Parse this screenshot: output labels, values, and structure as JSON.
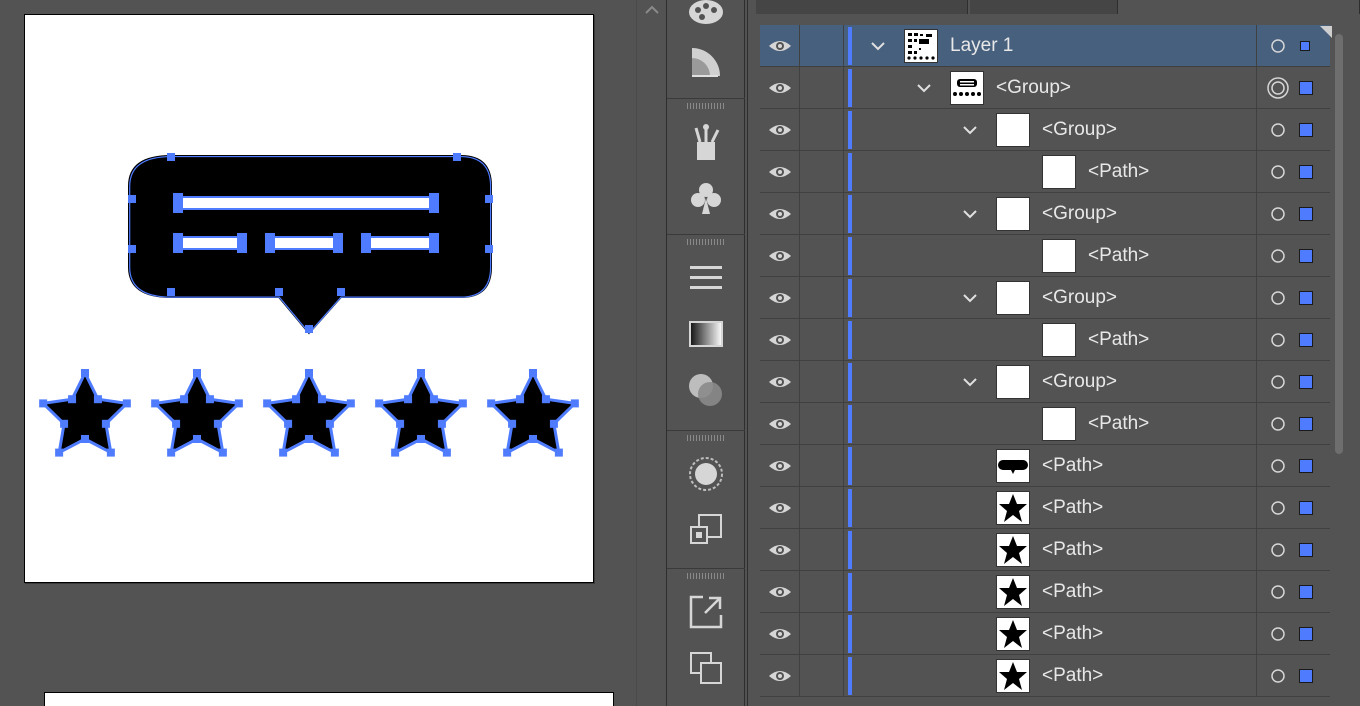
{
  "layers_panel": {
    "rows": [
      {
        "name": "Layer 1",
        "level": 0,
        "expandable": true,
        "thumb": "layer",
        "selected": true,
        "target": "circle"
      },
      {
        "name": "<Group>",
        "level": 1,
        "expandable": true,
        "thumb": "group-speech",
        "selected": false,
        "target": "double-circle"
      },
      {
        "name": "<Group>",
        "level": 2,
        "expandable": true,
        "thumb": "blank",
        "selected": false,
        "target": "circle"
      },
      {
        "name": "<Path>",
        "level": 3,
        "expandable": false,
        "thumb": "blank",
        "selected": false,
        "target": "circle"
      },
      {
        "name": "<Group>",
        "level": 2,
        "expandable": true,
        "thumb": "blank",
        "selected": false,
        "target": "circle"
      },
      {
        "name": "<Path>",
        "level": 3,
        "expandable": false,
        "thumb": "blank",
        "selected": false,
        "target": "circle"
      },
      {
        "name": "<Group>",
        "level": 2,
        "expandable": true,
        "thumb": "blank",
        "selected": false,
        "target": "circle"
      },
      {
        "name": "<Path>",
        "level": 3,
        "expandable": false,
        "thumb": "blank",
        "selected": false,
        "target": "circle"
      },
      {
        "name": "<Group>",
        "level": 2,
        "expandable": true,
        "thumb": "blank",
        "selected": false,
        "target": "circle"
      },
      {
        "name": "<Path>",
        "level": 3,
        "expandable": false,
        "thumb": "blank",
        "selected": false,
        "target": "circle"
      },
      {
        "name": "<Path>",
        "level": 2,
        "expandable": false,
        "thumb": "bubble",
        "selected": false,
        "target": "circle"
      },
      {
        "name": "<Path>",
        "level": 2,
        "expandable": false,
        "thumb": "star",
        "selected": false,
        "target": "circle"
      },
      {
        "name": "<Path>",
        "level": 2,
        "expandable": false,
        "thumb": "star",
        "selected": false,
        "target": "circle"
      },
      {
        "name": "<Path>",
        "level": 2,
        "expandable": false,
        "thumb": "star",
        "selected": false,
        "target": "circle"
      },
      {
        "name": "<Path>",
        "level": 2,
        "expandable": false,
        "thumb": "star",
        "selected": false,
        "target": "circle"
      },
      {
        "name": "<Path>",
        "level": 2,
        "expandable": false,
        "thumb": "star",
        "selected": false,
        "target": "circle"
      }
    ]
  },
  "dock": {
    "icons": [
      "palette-icon",
      "gradient-fan-icon",
      "brushes-icon",
      "symbols-club-icon",
      "stroke-lines-icon",
      "gradient-icon",
      "transparency-icon",
      "appearance-icon",
      "graphic-styles-icon",
      "export-icon",
      "artboards-icon"
    ]
  },
  "colors": {
    "selection": "#4f7cff",
    "panel_bg": "#535353",
    "selected_row": "#47607e"
  }
}
